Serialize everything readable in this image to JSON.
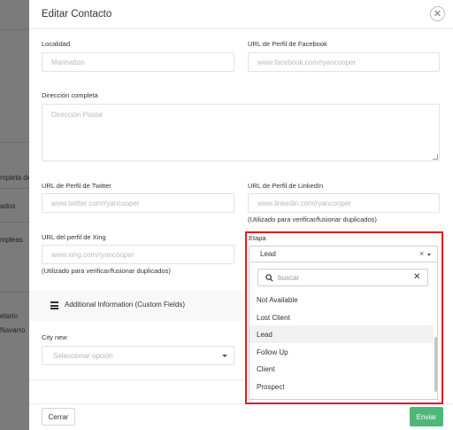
{
  "background": {
    "fragments": [
      "mpleta de",
      "ados",
      "mpleas",
      "etario",
      "Navarro"
    ]
  },
  "modal": {
    "title": "Editar Contacto",
    "close_glyph": "✕",
    "fields": {
      "localidad": {
        "label": "Localidad",
        "placeholder": "Manhattan"
      },
      "facebook": {
        "label": "URL de Perfil de Facebook",
        "placeholder": "www.facebook.com/ryancooper"
      },
      "direccion": {
        "label": "Dirección completa",
        "placeholder": "Dirección Postal"
      },
      "twitter": {
        "label": "URL de Perfil de Twitter",
        "placeholder": "www.twitter.com/ryancooper"
      },
      "linkedin": {
        "label": "URL de Perfil de LinkedIn",
        "placeholder": "www.linkedin.com/ryancooper",
        "hint": "(Utilizado para verificar/fusionar duplicados)"
      },
      "xing": {
        "label": "URL del perfil de Xing",
        "placeholder": "www.xing.com/ryancooper",
        "hint": "(Utilizado para verificar/fusionar duplicados)"
      }
    },
    "custom_fields": {
      "title": "Additional Information (Custom Fields)",
      "icon": "list-icon",
      "city": {
        "label": "City new",
        "placeholder": "Seleccionar opción"
      }
    },
    "stage": {
      "label": "Etapa",
      "selected": "Lead",
      "clear_glyph": "×",
      "search_placeholder": "buscar",
      "search_clear": "✕",
      "options": [
        "Not Available",
        "Lost Client",
        "Lead",
        "Follow Up",
        "Client",
        "Prospect"
      ],
      "active_option": "Lead"
    },
    "buttons": {
      "close": "Cerrar",
      "submit": "Enviar"
    }
  },
  "colors": {
    "highlight": "#e11b1b",
    "submit": "#4eb879",
    "overlay": "#7b7b7b"
  }
}
